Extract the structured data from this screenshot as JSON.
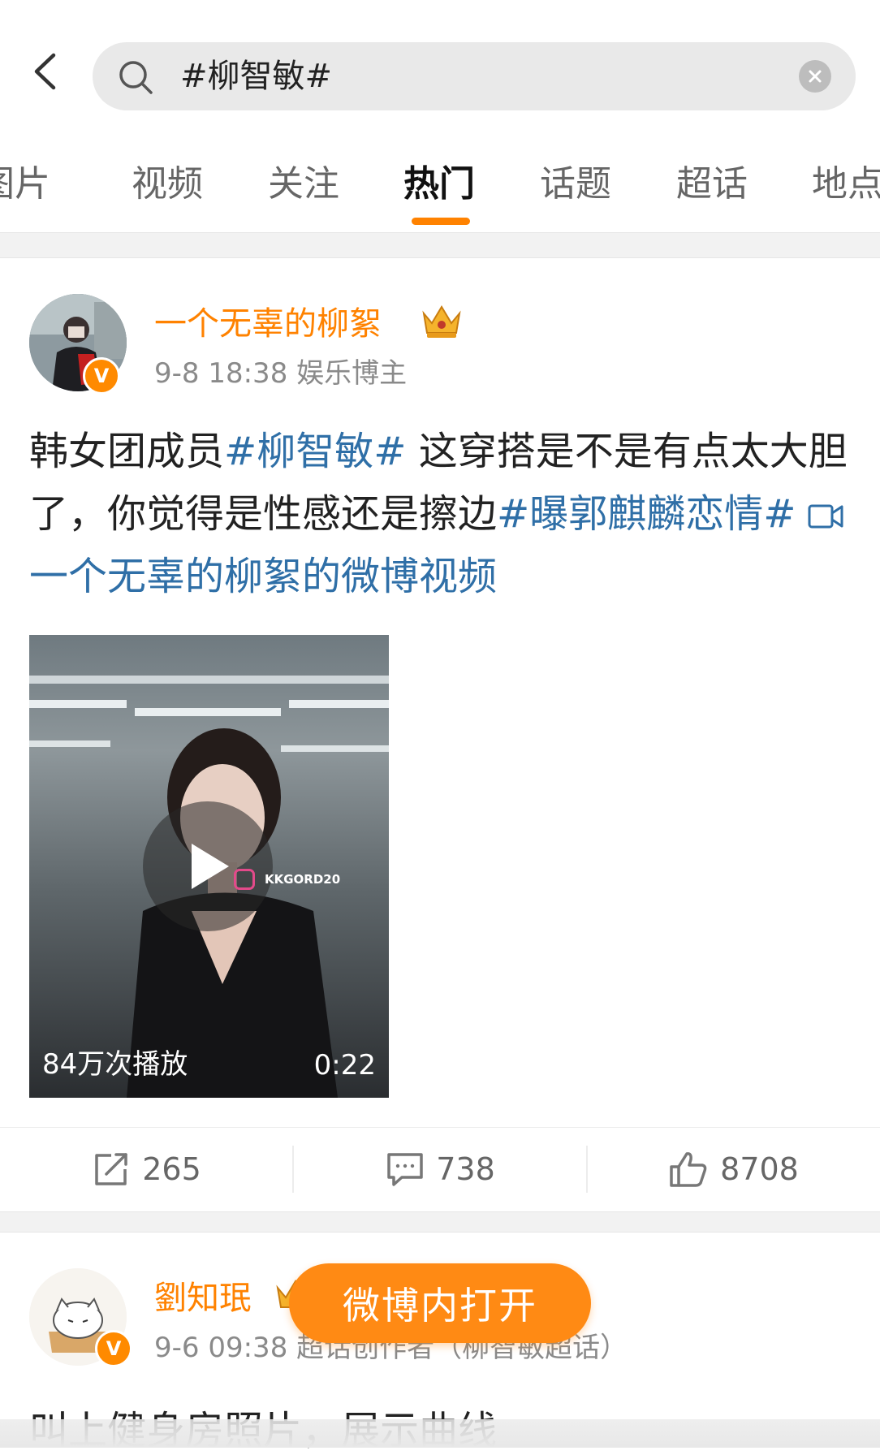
{
  "search": {
    "query": "#柳智敏#"
  },
  "tabs": [
    {
      "label": "图片"
    },
    {
      "label": "视频"
    },
    {
      "label": "关注"
    },
    {
      "label": "热门"
    },
    {
      "label": "话题"
    },
    {
      "label": "超话"
    },
    {
      "label": "地点"
    }
  ],
  "active_tab": "热门",
  "post1": {
    "username": "一个无辜的柳絮",
    "verified_mark": "V",
    "meta": "9-8 18:38 娱乐博主",
    "text_intro": "韩女团成员",
    "tag1": "#柳智敏#",
    "text_body": " 这穿搭是不是有点太大胆了，你觉得是性感还是擦边",
    "tag2": "#曝郭麒麟恋情#",
    "video_link": "一个无辜的柳絮的微博视频",
    "video": {
      "plays": "84万次播放",
      "duration": "0:22",
      "watermark": "KKGORD20"
    },
    "actions": {
      "reposts": "265",
      "comments": "738",
      "likes": "8708"
    }
  },
  "post2": {
    "username": "劉知珉",
    "verified_mark": "V",
    "meta": "9-6 09:38 超话创作者（柳智敏超话）",
    "text": "叫上健身房照片，展示曲线"
  },
  "open_in_app": "微博内打开",
  "colors": {
    "accent": "#ff8200",
    "link": "#2f6fa7"
  }
}
